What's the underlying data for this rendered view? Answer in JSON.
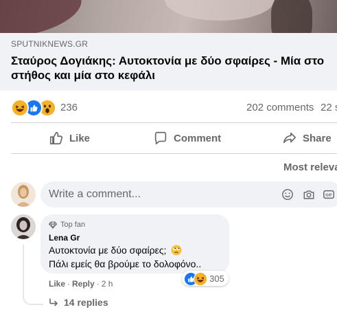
{
  "link_preview": {
    "source": "SPUTNIKNEWS.GR",
    "headline": "Σταύρος Δογιάκης: Αυτοκτονία με δύο σφαίρες - Μία στο στήθος και μία στο κεφάλι"
  },
  "post_stats": {
    "reaction_icons": [
      "haha-reaction-icon",
      "like-reaction-icon",
      "wow-reaction-icon"
    ],
    "reaction_count": "236",
    "comments_count": "202 comments",
    "shares_count": "22 s"
  },
  "actions": {
    "like_label": "Like",
    "comment_label": "Comment",
    "share_label": "Share"
  },
  "comments_section": {
    "sort_label": "Most releva",
    "input_placeholder": "Write a comment..."
  },
  "comment": {
    "badge": "Top fan",
    "author": "Lena Gr",
    "line1": "Αυτοκτονία με δύο σφαίρες;",
    "line2": "Πάλι εμείς θα βρούμε το δολοφόνο..",
    "reaction_count": "305",
    "like_label": "Like",
    "reply_label": "Reply",
    "time": "2 h",
    "replies_label": "14 replies"
  },
  "colors": {
    "accent": "#1877f2",
    "secondary_text": "#65676b",
    "surface": "#f0f2f5"
  }
}
